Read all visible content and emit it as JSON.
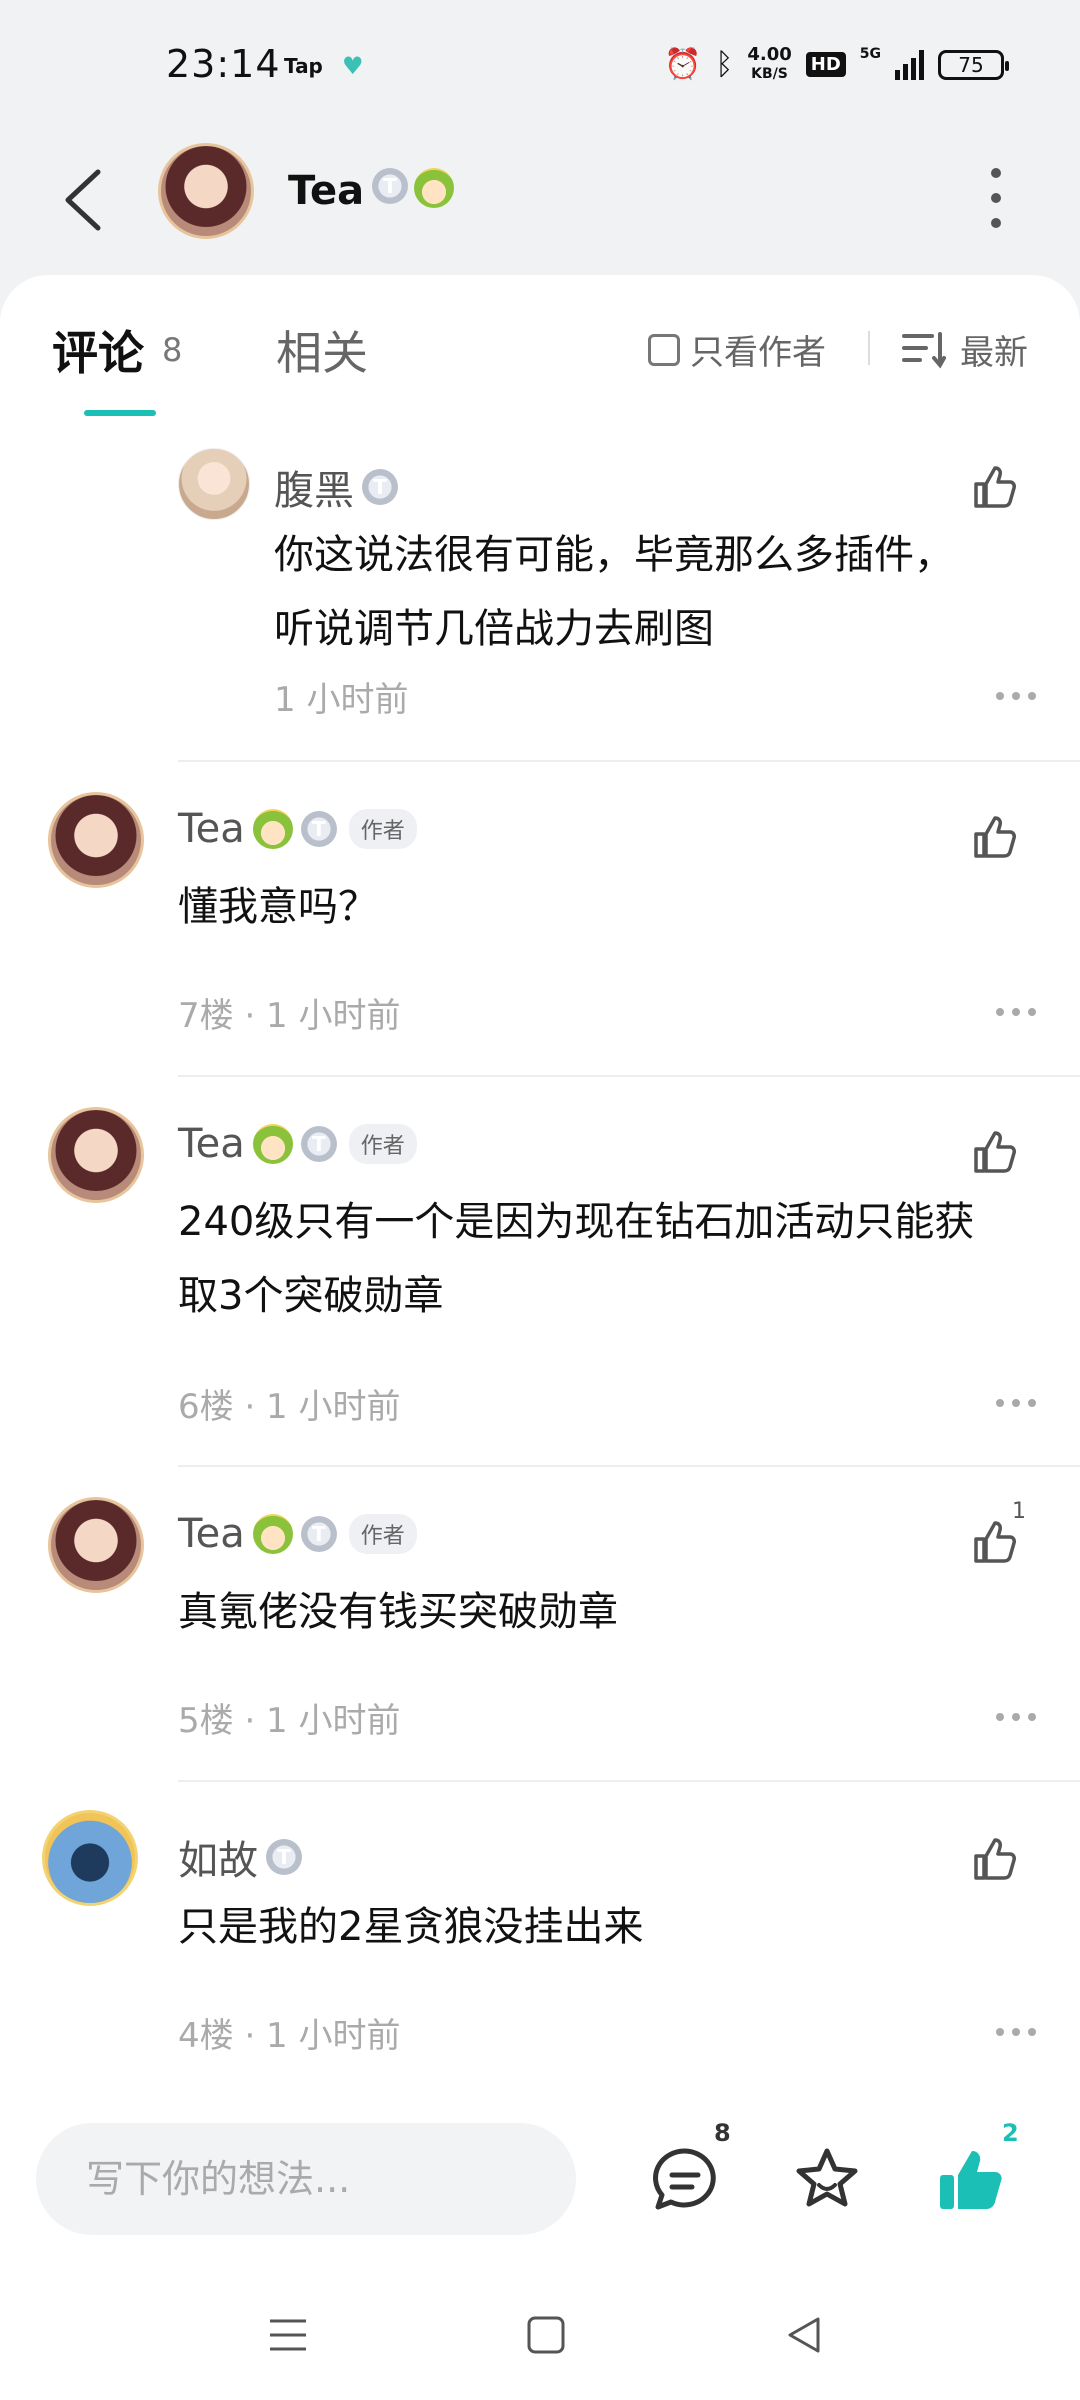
{
  "status_bar": {
    "time": "23:14",
    "app_indicator": "Tap",
    "speed_value": "4.00",
    "speed_unit": "KB/S",
    "hd": "HD",
    "network": "5G",
    "battery": "75"
  },
  "header": {
    "author_name": "Tea"
  },
  "tabs": {
    "comments_label": "评论",
    "comments_count": "8",
    "related_label": "相关",
    "only_author_label": "只看作者",
    "sort_label": "最新"
  },
  "comments": [
    {
      "name": "腹黑",
      "text_lines": [
        "你这说法很有可能，毕竟那么多插件，",
        "听说调节几倍战力去刷图"
      ],
      "meta": "1 小时前"
    },
    {
      "name": "Tea",
      "author_tag": "作者",
      "text_lines": [
        "懂我意吗？"
      ],
      "meta": "7楼 · 1 小时前"
    },
    {
      "name": "Tea",
      "author_tag": "作者",
      "text_lines": [
        "240级只有一个是因为现在钻石加活动只能获",
        "取3个突破勋章"
      ],
      "meta": "6楼 · 1 小时前"
    },
    {
      "name": "Tea",
      "author_tag": "作者",
      "text_lines": [
        "真氪佬没有钱买突破勋章"
      ],
      "meta": "5楼 · 1 小时前",
      "likes": "1"
    },
    {
      "name": "如故",
      "text_lines": [
        "只是我的2星贪狼没挂出来"
      ],
      "meta": "4楼 · 1 小时前"
    }
  ],
  "bottom_bar": {
    "input_placeholder": "写下你的想法...",
    "comment_count": "8",
    "like_count": "2"
  },
  "colors": {
    "accent": "#1bbfb5",
    "text_secondary": "#aaaaaa"
  }
}
